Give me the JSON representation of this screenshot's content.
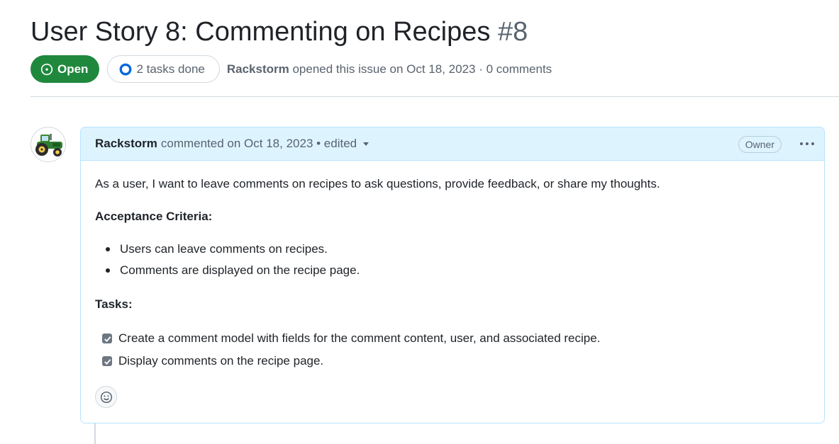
{
  "issue": {
    "title": "User Story 8: Commenting on Recipes",
    "number": "#8",
    "state": "Open",
    "tasks_done": "2 tasks done",
    "author": "Rackstorm",
    "opened_text": "opened this issue on Oct 18, 2023 · 0 comments"
  },
  "comment": {
    "author": "Rackstorm",
    "meta": "commented on Oct 18, 2023 • edited",
    "role_badge": "Owner",
    "body_text": "As a user, I want to leave comments on recipes to ask questions, provide feedback, or share my thoughts.",
    "criteria_heading": "Acceptance Criteria:",
    "criteria": [
      "Users can leave comments on recipes.",
      "Comments are displayed on the recipe page."
    ],
    "tasks_heading": "Tasks:",
    "tasks": [
      {
        "label": "Create a comment model with fields for the comment content, user, and associated recipe.",
        "checked": true
      },
      {
        "label": "Display comments on the recipe page.",
        "checked": true
      }
    ]
  },
  "icons": {
    "state": "issue-opened-icon",
    "tasks": "progress-circle-icon",
    "caret": "triangle-down-icon",
    "more": "kebab-horizontal-icon",
    "reaction": "smiley-icon",
    "avatar": "tractor-icon"
  },
  "colors": {
    "open_green": "#1f883d",
    "header_blue": "#ddf4ff",
    "border_blue": "#b6e3ff",
    "progress_blue": "#0969da"
  }
}
